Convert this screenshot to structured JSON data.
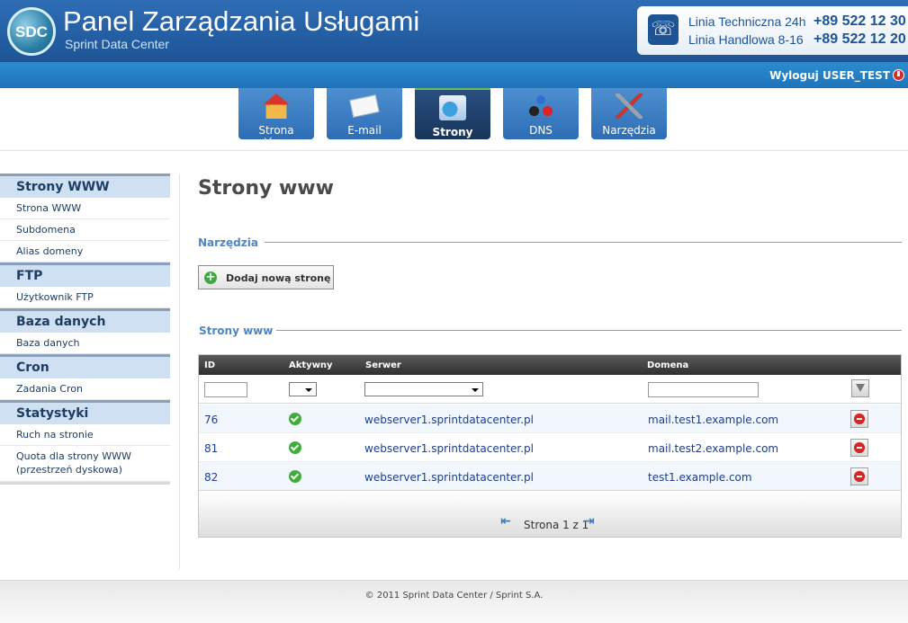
{
  "header": {
    "logo_text": "SDC",
    "title": "Panel Zarządzania Usługami",
    "subtitle": "Sprint Data Center",
    "contact": [
      {
        "label": "Linia Techniczna 24h",
        "number": "+89 522 12 30"
      },
      {
        "label": "Linia Handlowa 8-16",
        "number": "+89 522 12 20"
      }
    ]
  },
  "userbar": {
    "logout_label": "Wyloguj USER_TEST"
  },
  "nav": {
    "tabs": [
      {
        "label": "Strona główna",
        "icon": "home-icon",
        "active": false
      },
      {
        "label": "E-mail",
        "icon": "envelope-icon",
        "active": false
      },
      {
        "label": "Strony",
        "icon": "web-pages-icon",
        "active": true
      },
      {
        "label": "DNS",
        "icon": "dns-network-icon",
        "active": false
      },
      {
        "label": "Narzędzia",
        "icon": "tools-icon",
        "active": false
      }
    ]
  },
  "sidebar": {
    "groups": [
      {
        "title": "Strony WWW",
        "items": [
          "Strona WWW",
          "Subdomena",
          "Alias domeny"
        ]
      },
      {
        "title": "FTP",
        "items": [
          "Użytkownik FTP"
        ]
      },
      {
        "title": "Baza danych",
        "items": [
          "Baza danych"
        ]
      },
      {
        "title": "Cron",
        "items": [
          "Zadania Cron"
        ]
      },
      {
        "title": "Statystyki",
        "items": [
          "Ruch na stronie",
          "Quota dla strony WWW (przestrzeń dyskowa)"
        ]
      }
    ]
  },
  "main": {
    "page_title": "Strony www",
    "tools_section": "Narzędzia",
    "add_button": "Dodaj nową stronę",
    "list_section": "Strony www",
    "columns": [
      "ID",
      "Aktywny",
      "Serwer",
      "Domena"
    ],
    "filters": {
      "id": "",
      "active": "",
      "server": "",
      "domain": ""
    },
    "rows": [
      {
        "id": "76",
        "active": true,
        "server": "webserver1.sprintdatacenter.pl",
        "domain": "mail.test1.example.com"
      },
      {
        "id": "81",
        "active": true,
        "server": "webserver1.sprintdatacenter.pl",
        "domain": "mail.test2.example.com"
      },
      {
        "id": "82",
        "active": true,
        "server": "webserver1.sprintdatacenter.pl",
        "domain": "test1.example.com"
      }
    ],
    "pager_text": "Strona 1 z 1"
  },
  "footer": {
    "text": "© 2011 Sprint Data Center / Sprint S.A."
  },
  "colors": {
    "header": "#1d5496",
    "userbar": "#2b8cd0",
    "accent": "#4d86c4",
    "active_tab": "#18355a"
  }
}
